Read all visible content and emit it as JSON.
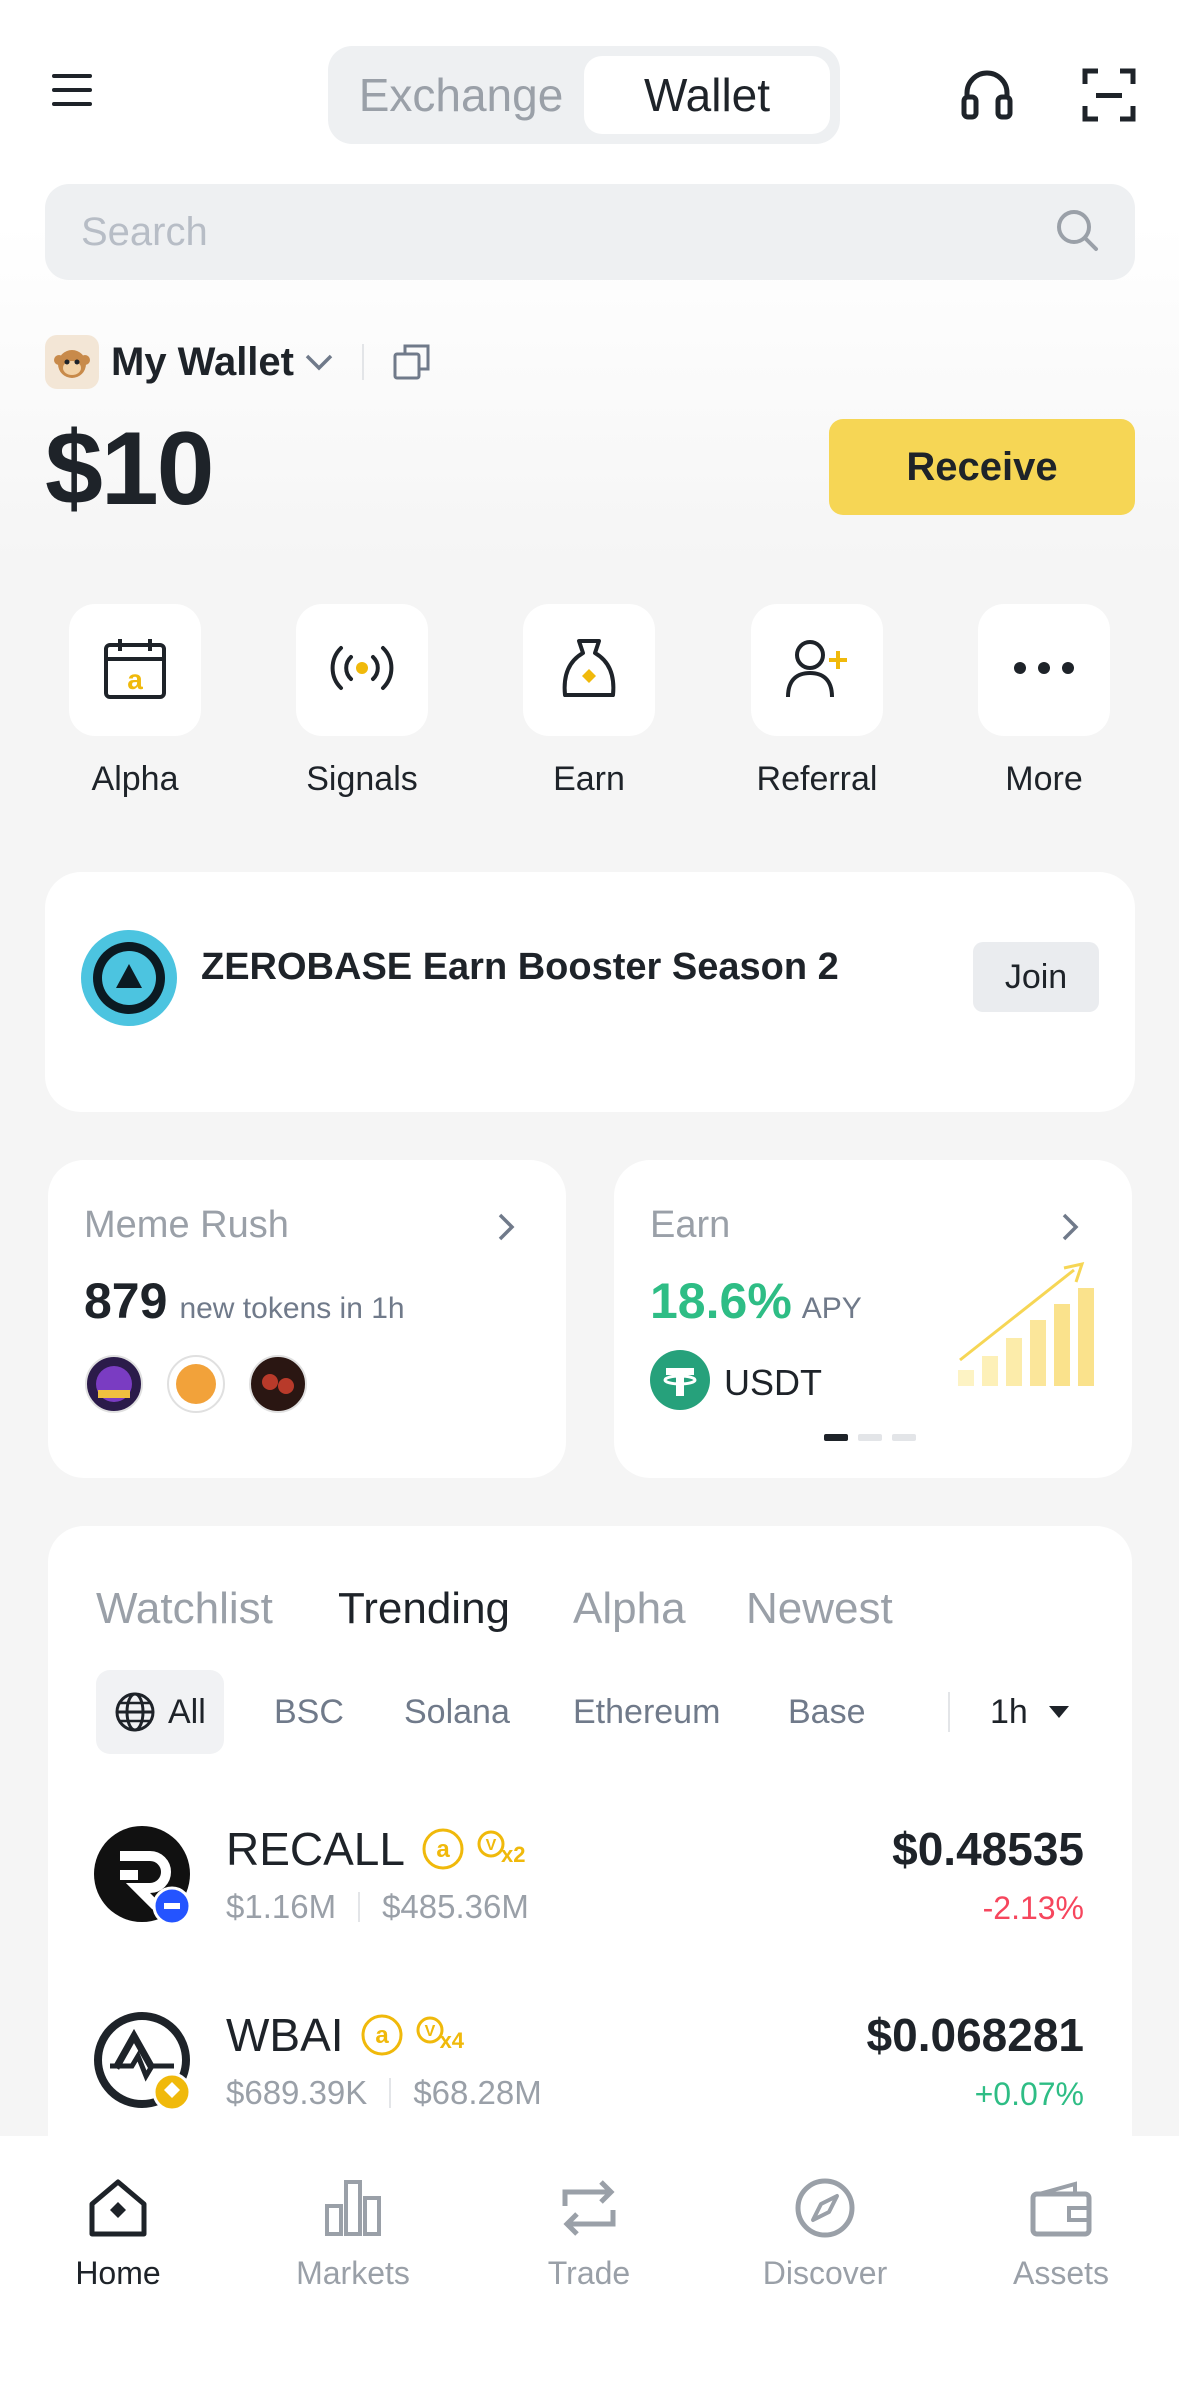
{
  "header": {
    "tabs": [
      {
        "label": "Exchange",
        "active": false
      },
      {
        "label": "Wallet",
        "active": true
      }
    ]
  },
  "search": {
    "placeholder": "Search"
  },
  "wallet": {
    "name": "My Wallet",
    "balance": "$10",
    "receive_label": "Receive"
  },
  "quick_actions": [
    {
      "label": "Alpha",
      "icon": "calendar-alpha-icon"
    },
    {
      "label": "Signals",
      "icon": "signals-icon"
    },
    {
      "label": "Earn",
      "icon": "money-bag-icon"
    },
    {
      "label": "Referral",
      "icon": "add-user-icon"
    },
    {
      "label": "More",
      "icon": "more-dots-icon"
    }
  ],
  "banner": {
    "title": "ZEROBASE Earn Booster Season 2",
    "join_label": "Join"
  },
  "meme_rush": {
    "title": "Meme Rush",
    "count": "879",
    "desc": "new tokens in 1h"
  },
  "earn_card": {
    "title": "Earn",
    "apy_value": "18.6%",
    "apy_label": "APY",
    "asset": "USDT"
  },
  "token_tabs": [
    {
      "label": "Watchlist",
      "active": false
    },
    {
      "label": "Trending",
      "active": true
    },
    {
      "label": "Alpha",
      "active": false
    },
    {
      "label": "Newest",
      "active": false
    }
  ],
  "chains": [
    {
      "label": "All",
      "active": true
    },
    {
      "label": "BSC",
      "active": false
    },
    {
      "label": "Solana",
      "active": false
    },
    {
      "label": "Ethereum",
      "active": false
    },
    {
      "label": "Base",
      "active": false
    }
  ],
  "timeframe": "1h",
  "tokens": [
    {
      "name": "RECALL",
      "multiplier": "x2",
      "volume": "$1.16M",
      "mcap": "$485.36M",
      "price": "$0.48535",
      "change": "-2.13%"
    },
    {
      "name": "WBAI",
      "multiplier": "x4",
      "volume": "$689.39K",
      "mcap": "$68.28M",
      "price": "$0.068281",
      "change": "+0.07%"
    }
  ],
  "bottom_nav": [
    {
      "label": "Home",
      "active": true
    },
    {
      "label": "Markets",
      "active": false
    },
    {
      "label": "Trade",
      "active": false
    },
    {
      "label": "Discover",
      "active": false
    },
    {
      "label": "Assets",
      "active": false
    }
  ],
  "colors": {
    "accent_yellow": "#F6D655",
    "positive": "#2EBD85",
    "negative": "#F6465D",
    "muted": "#9AA0A8"
  }
}
